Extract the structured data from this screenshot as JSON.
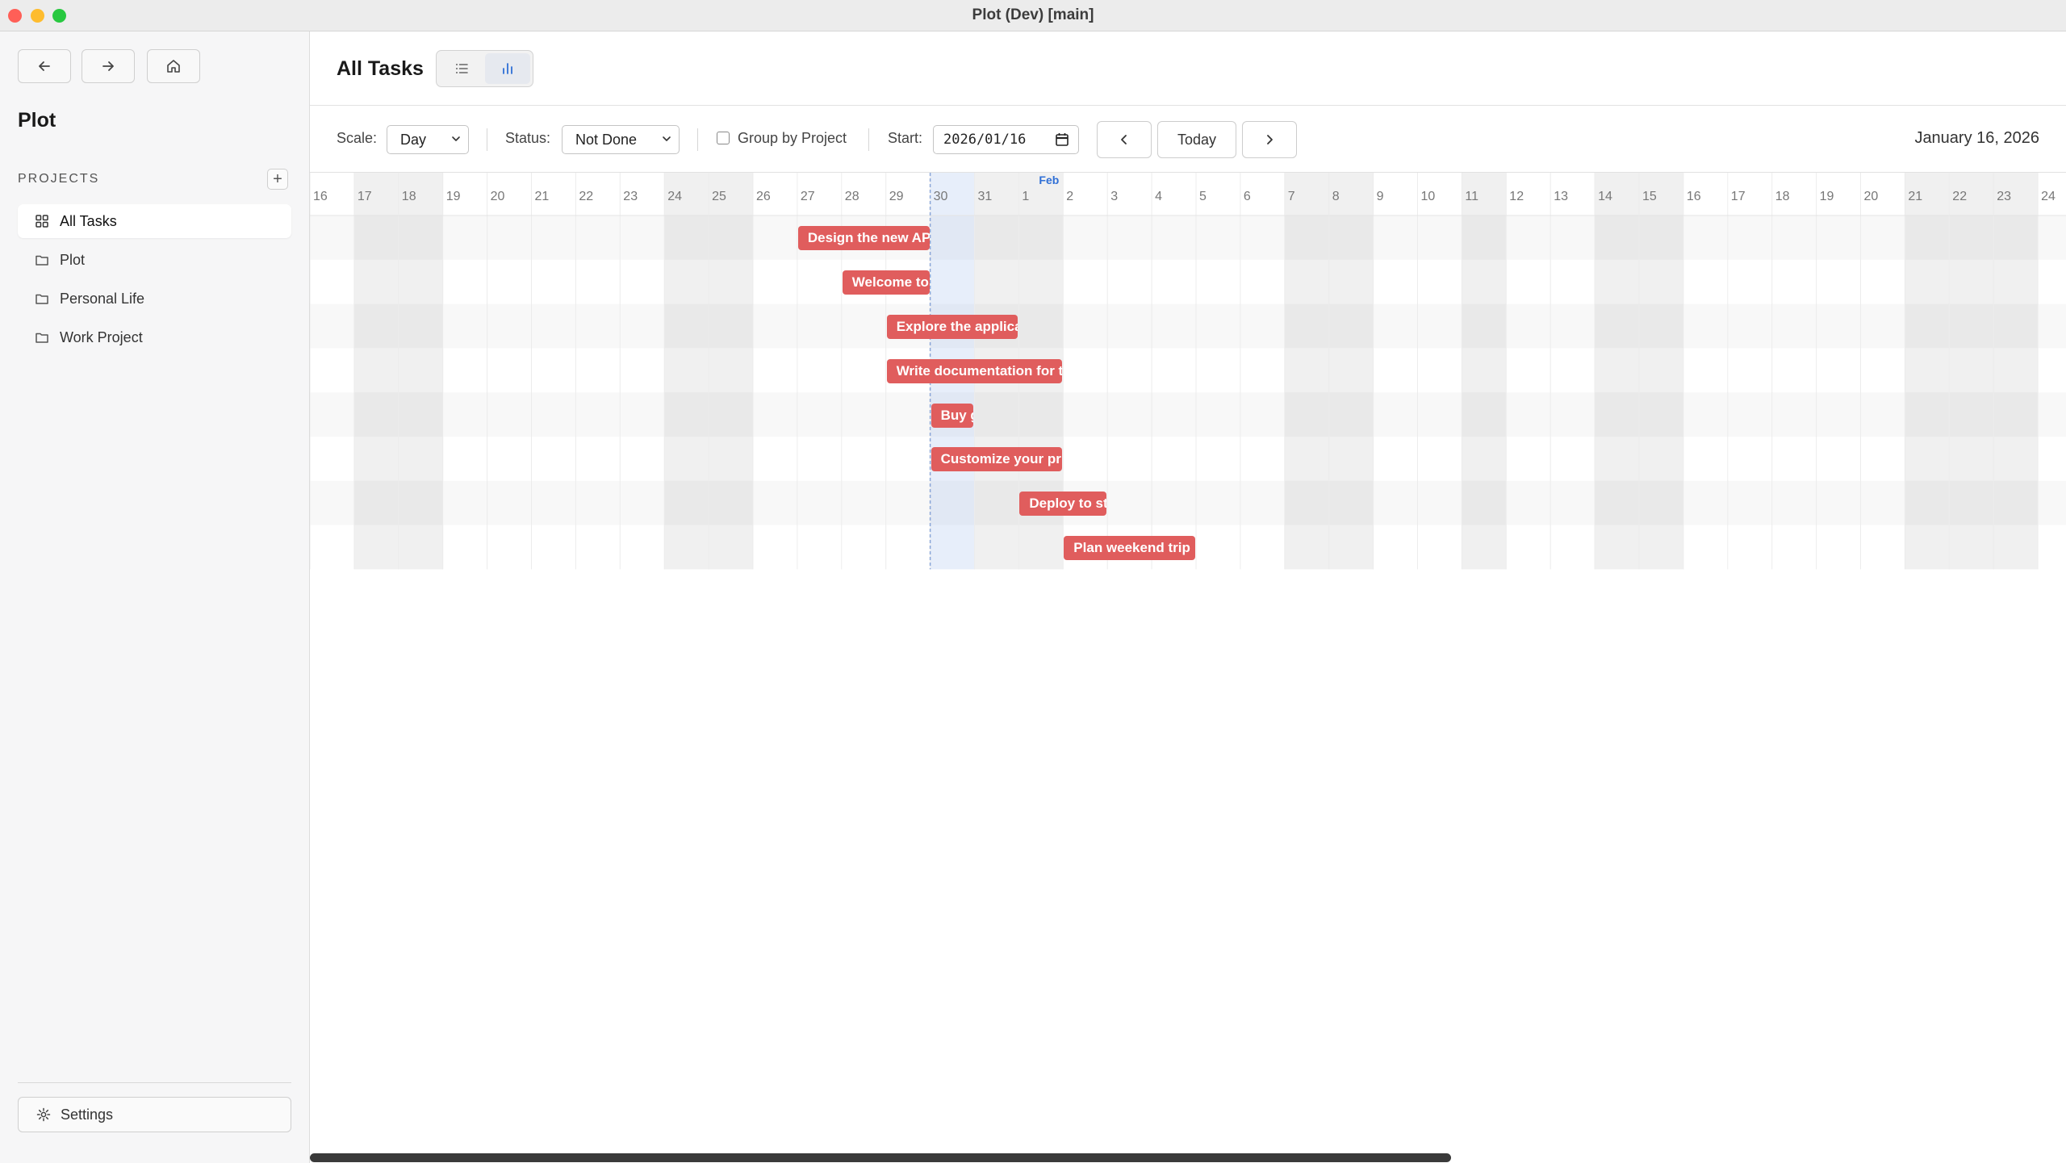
{
  "window": {
    "title": "Plot (Dev) [main]"
  },
  "sidebar": {
    "title": "Plot",
    "section_label": "PROJECTS",
    "add_label": "+",
    "items": [
      {
        "label": "All Tasks",
        "icon": "grid-icon",
        "active": true
      },
      {
        "label": "Plot",
        "icon": "folder-icon"
      },
      {
        "label": "Personal Life",
        "icon": "folder-icon"
      },
      {
        "label": "Work Project",
        "icon": "folder-icon"
      }
    ],
    "settings_label": "Settings"
  },
  "header": {
    "title": "All Tasks",
    "views": [
      "list-icon",
      "chart-icon"
    ],
    "active_view": "chart-icon"
  },
  "toolbar": {
    "scale_label": "Scale:",
    "scale_value": "Day",
    "status_label": "Status:",
    "status_value": "Not Done",
    "group_label": "Group by Project",
    "group_checked": false,
    "start_label": "Start:",
    "start_value": "2026/01/16",
    "today_label": "Today",
    "current_date": "January 16, 2026"
  },
  "gantt": {
    "month_marker": "Feb",
    "today_index": 14,
    "days": [
      "16",
      "17",
      "18",
      "19",
      "20",
      "21",
      "22",
      "23",
      "24",
      "25",
      "26",
      "27",
      "28",
      "29",
      "30",
      "31",
      "1",
      "2",
      "3",
      "4",
      "5",
      "6",
      "7",
      "8",
      "9",
      "10",
      "11",
      "12",
      "13",
      "14",
      "15",
      "16",
      "17",
      "18",
      "19",
      "20",
      "21",
      "22",
      "23",
      "24"
    ],
    "weekend_indices": [
      1,
      2,
      8,
      9,
      15,
      16,
      22,
      23,
      26,
      29,
      30,
      36,
      37,
      38
    ],
    "bar_color": "#e05d5d",
    "tasks": [
      {
        "label": "Design the new AP",
        "start": 11,
        "span": 3
      },
      {
        "label": "Welcome to",
        "start": 12,
        "span": 2
      },
      {
        "label": "Explore the applica",
        "start": 13,
        "span": 3
      },
      {
        "label": "Write documentation for t",
        "start": 13,
        "span": 4
      },
      {
        "label": "Buy g",
        "start": 14,
        "span": 1
      },
      {
        "label": "Customize your pr",
        "start": 14,
        "span": 3
      },
      {
        "label": "Deploy to st",
        "start": 16,
        "span": 2
      },
      {
        "label": "Plan weekend trip",
        "start": 17,
        "span": 3
      }
    ]
  }
}
